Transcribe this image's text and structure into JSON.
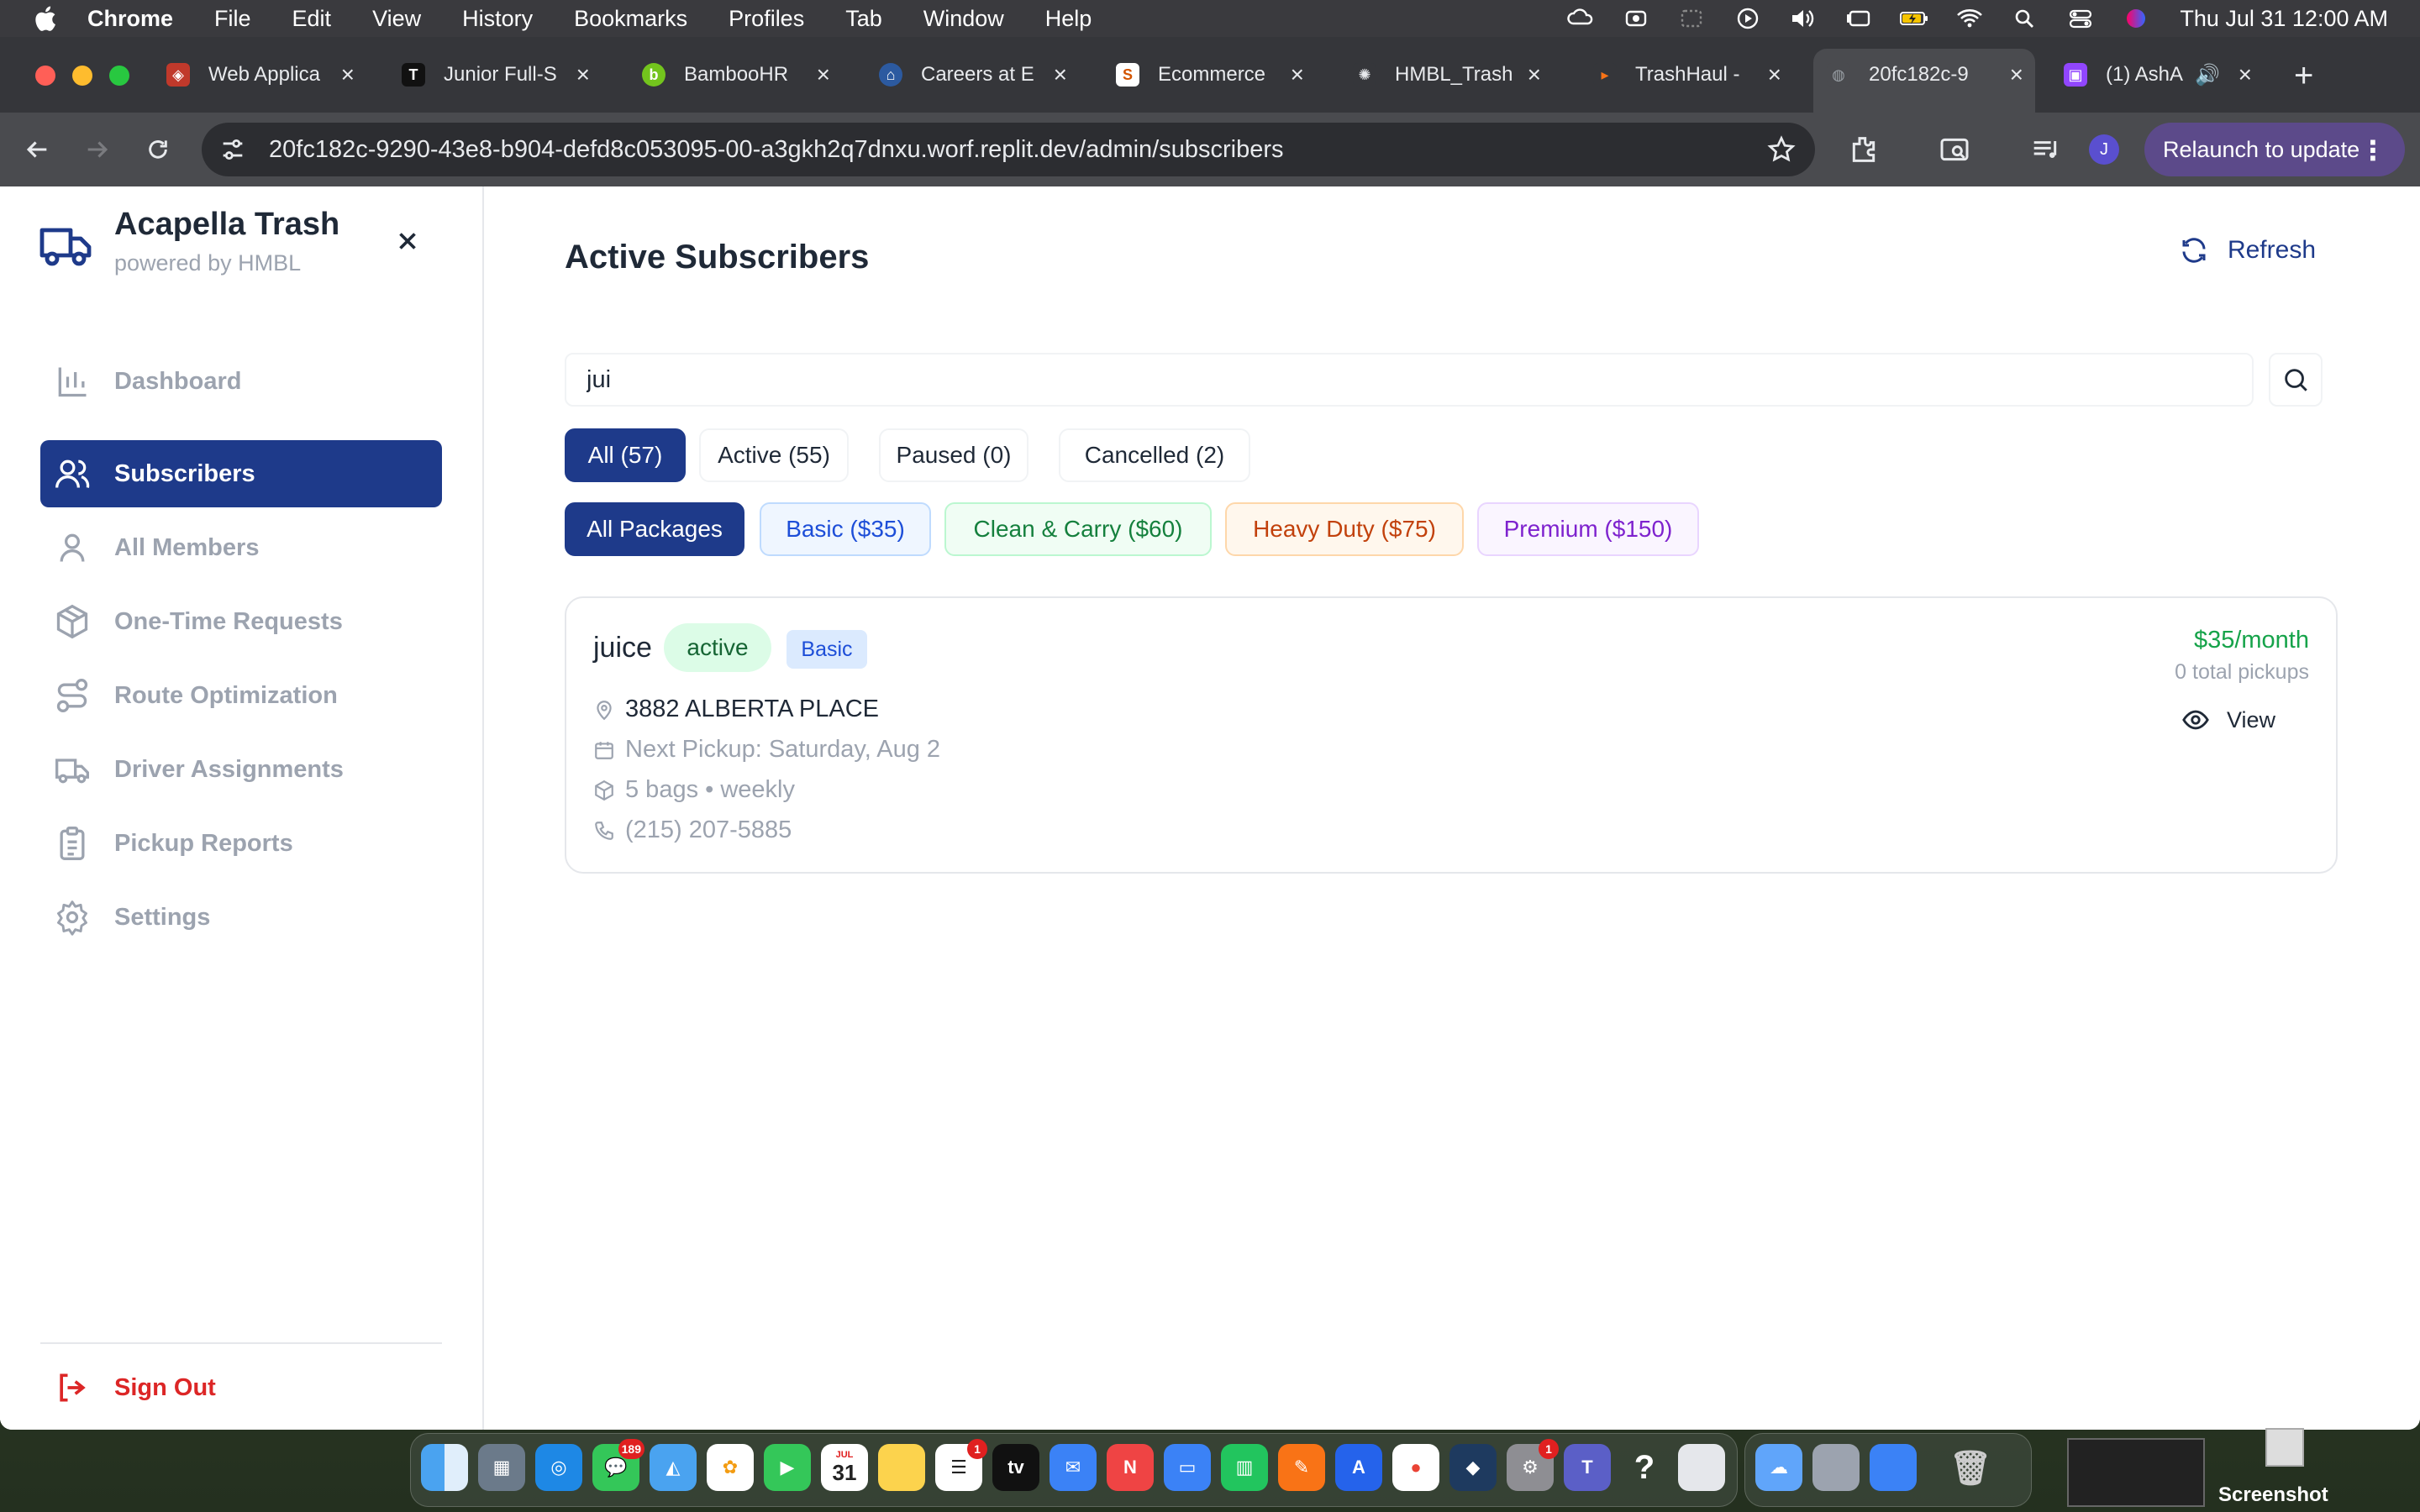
{
  "menubar": {
    "app": "Chrome",
    "items": [
      "File",
      "Edit",
      "View",
      "History",
      "Bookmarks",
      "Profiles",
      "Tab",
      "Window",
      "Help"
    ],
    "clock": "Thu Jul 31  12:00 AM"
  },
  "tabs": [
    {
      "label": "Web Applica",
      "color": "#c0392b",
      "glyph": "◈"
    },
    {
      "label": "Junior Full-S",
      "color": "#111111",
      "glyph": "T"
    },
    {
      "label": "BambooHR",
      "color": "#73c41d",
      "glyph": "b"
    },
    {
      "label": "Careers at E",
      "color": "#2c5aa0",
      "glyph": "⌂"
    },
    {
      "label": "Ecommerce",
      "color": "#ffffff",
      "glyph": "S"
    },
    {
      "label": "HMBL_Trash",
      "color": "#35363a",
      "glyph": "✺"
    },
    {
      "label": "TrashHaul -",
      "color": "#f97316",
      "glyph": "▸"
    },
    {
      "label": "20fc182c-9",
      "color": "#9aa0a6",
      "glyph": "◍"
    },
    {
      "label": "(1) AshA",
      "color": "#9146ff",
      "glyph": "▣"
    }
  ],
  "toolbar": {
    "url": "20fc182c-9290-43e8-b904-defd8c053095-00-a3gkh2q7dnxu.worf.replit.dev/admin/subscribers",
    "profile_initial": "J",
    "relaunch_label": "Relaunch to update"
  },
  "brand": {
    "title": "Acapella Trash",
    "subtitle": "powered by HMBL"
  },
  "sidebar": {
    "items": [
      {
        "label": "Dashboard",
        "icon": "bar-chart-icon"
      },
      {
        "label": "Subscribers",
        "icon": "users-icon"
      },
      {
        "label": "All Members",
        "icon": "user-icon"
      },
      {
        "label": "One-Time Requests",
        "icon": "box-icon"
      },
      {
        "label": "Route Optimization",
        "icon": "route-icon"
      },
      {
        "label": "Driver Assignments",
        "icon": "truck-icon"
      },
      {
        "label": "Pickup Reports",
        "icon": "clipboard-icon"
      },
      {
        "label": "Settings",
        "icon": "gear-icon"
      }
    ],
    "sign_out": "Sign Out"
  },
  "main": {
    "title": "Active Subscribers",
    "refresh_label": "Refresh",
    "search_value": "jui",
    "status_filters": [
      "All (57)",
      "Active (55)",
      "Paused (0)",
      "Cancelled (2)"
    ],
    "package_filters": [
      "All Packages",
      "Basic ($35)",
      "Clean & Carry ($60)",
      "Heavy Duty ($75)",
      "Premium ($150)"
    ]
  },
  "subscriber": {
    "name": "juice",
    "status": "active",
    "package": "Basic",
    "address": "3882 ALBERTA PLACE",
    "next_pickup": "Next Pickup: Saturday, Aug 2",
    "bags": "5 bags • weekly",
    "phone": "(215) 207-5885",
    "price": "$35/month",
    "pickups": "0 total pickups",
    "view_label": "View"
  },
  "dock": {
    "messages_badge": "189",
    "calendar_month": "JUL",
    "calendar_day": "31",
    "reminders_badge": "1",
    "settings_badge": "1",
    "screenshot_label": "Screenshot"
  },
  "colors": {
    "accent": "#1e3a8a",
    "active_green": "#16a34a",
    "danger": "#dc2626"
  }
}
